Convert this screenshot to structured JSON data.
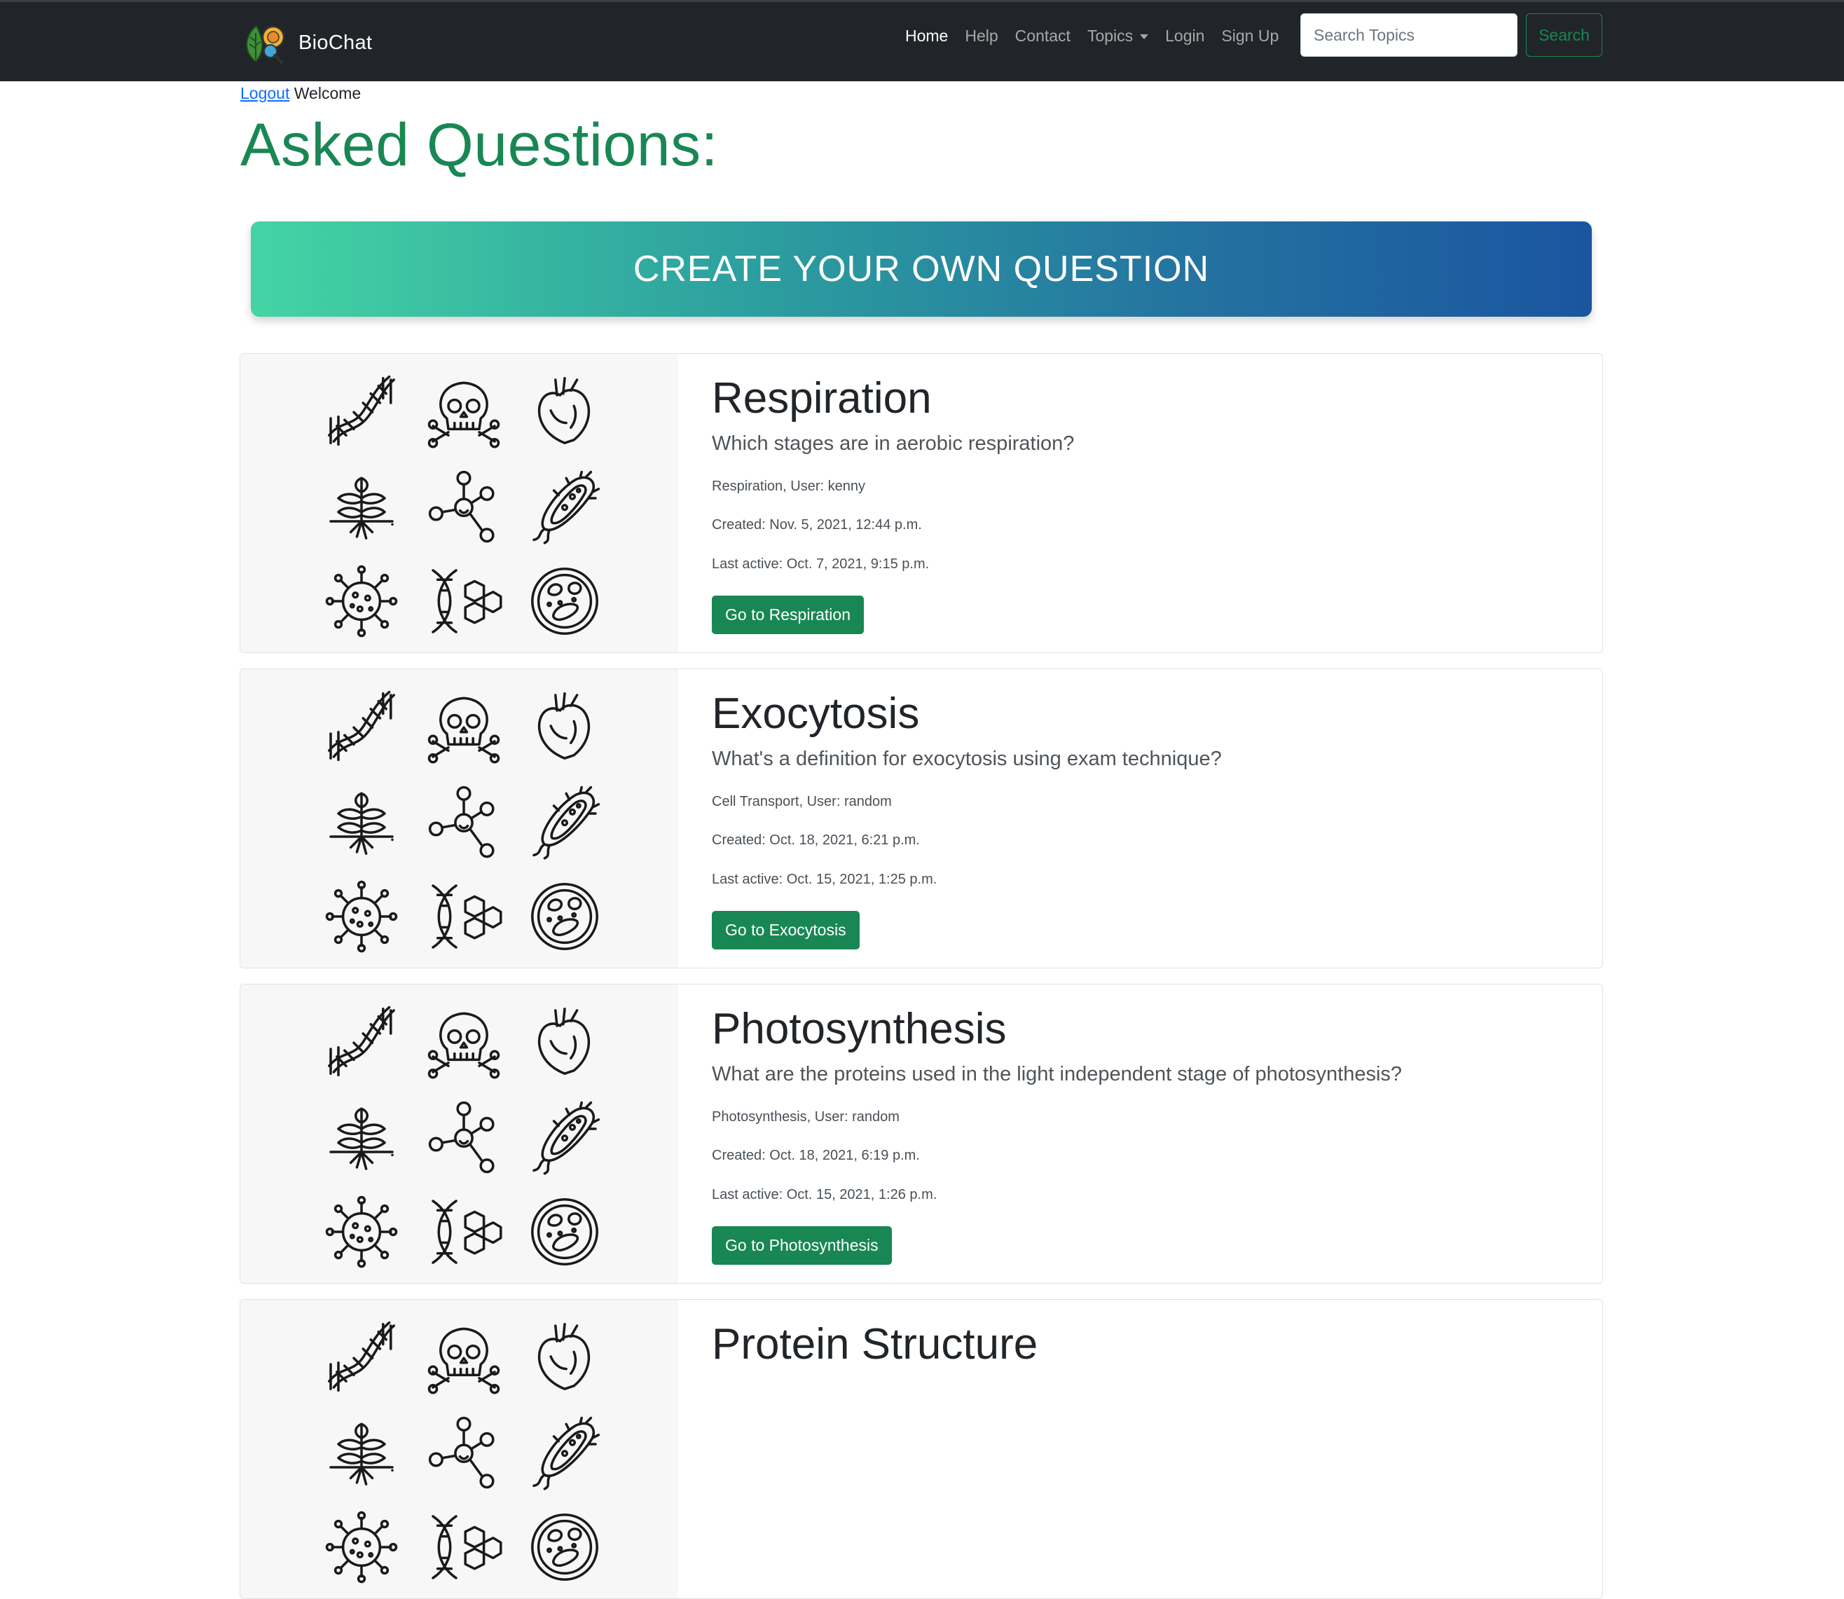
{
  "nav": {
    "brand": "BioChat",
    "links": [
      "Home",
      "Help",
      "Contact",
      "Topics",
      "Login",
      "Sign Up"
    ],
    "search_placeholder": "Search Topics",
    "search_button": "Search"
  },
  "user": {
    "logout_label": "Logout",
    "welcome": "Welcome"
  },
  "page_title": "Asked Questions:",
  "create_button": "CREATE YOUR OWN QUESTION",
  "icons": [
    "dna-icon",
    "skull-icon",
    "heart-icon",
    "plant-icon",
    "molecule-icon",
    "bacteria-icon",
    "virus-icon",
    "dna-hexagon-icon",
    "petri-dish-icon"
  ],
  "questions": [
    {
      "title": "Respiration",
      "question": "Which stages are in aerobic respiration?",
      "meta": "Respiration, User: kenny",
      "created": "Created: Nov. 5, 2021, 12:44 p.m.",
      "last_active": "Last active: Oct. 7, 2021, 9:15 p.m.",
      "button": "Go to Respiration"
    },
    {
      "title": "Exocytosis",
      "question": "What's a definition for exocytosis using exam technique?",
      "meta": "Cell Transport, User: random",
      "created": "Created: Oct. 18, 2021, 6:21 p.m.",
      "last_active": "Last active: Oct. 15, 2021, 1:25 p.m.",
      "button": "Go to Exocytosis"
    },
    {
      "title": "Photosynthesis",
      "question": "What are the proteins used in the light independent stage of photosynthesis?",
      "meta": "Photosynthesis, User: random",
      "created": "Created: Oct. 18, 2021, 6:19 p.m.",
      "last_active": "Last active: Oct. 15, 2021, 1:26 p.m.",
      "button": "Go to Photosynthesis"
    },
    {
      "title": "Protein Structure",
      "question": "",
      "meta": "",
      "created": "",
      "last_active": "",
      "button": ""
    }
  ]
}
